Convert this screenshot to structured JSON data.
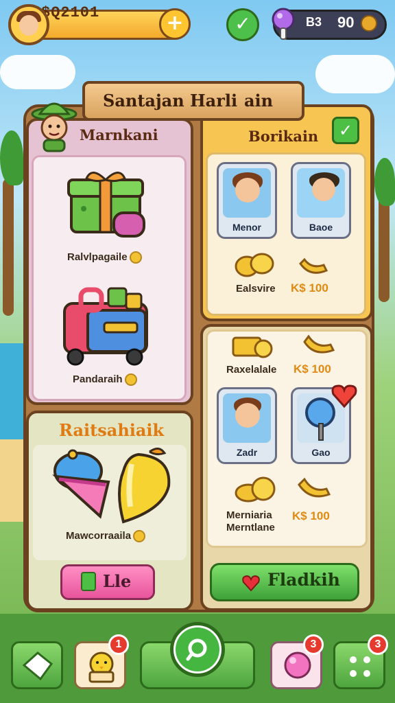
{
  "hud": {
    "coins": "$Q2101",
    "gem_label": "B3",
    "gem_value": "90",
    "colors": {
      "coin_pill": "#f2a92b",
      "gem_pill": "#3c3f55",
      "accent_green": "#4cc04a"
    }
  },
  "title": {
    "main": "Santajan Harli",
    "tail": "ain"
  },
  "left_top_panel": {
    "header": "Marnkani",
    "items": [
      {
        "label": "Ralvlpagaile",
        "icon": "gift-box-icon"
      },
      {
        "label": "Pandaraih",
        "icon": "toy-cart-icon"
      }
    ]
  },
  "left_bottom_panel": {
    "header": "Raitsahiaik",
    "item_label": "Mawcorraaila",
    "button": "Lle"
  },
  "right_top_panel": {
    "header": "Borikain",
    "cards": [
      {
        "label": "Menor"
      },
      {
        "label": "Baoe"
      }
    ],
    "rows": [
      {
        "label": "Ealsvire",
        "price": "K$ 100"
      }
    ]
  },
  "right_bottom_panel": {
    "rows": [
      {
        "label": "Raxelalale",
        "price": "K$ 100"
      },
      {
        "label": "Merniaria\nMerntlane",
        "price": "K$ 100"
      }
    ],
    "cards": [
      {
        "label": "Zadr"
      },
      {
        "label": "Gao"
      }
    ],
    "button": "Fladkih"
  },
  "bottom_nav": {
    "badges": {
      "food": "1",
      "bubble": "3",
      "more": "3"
    }
  }
}
